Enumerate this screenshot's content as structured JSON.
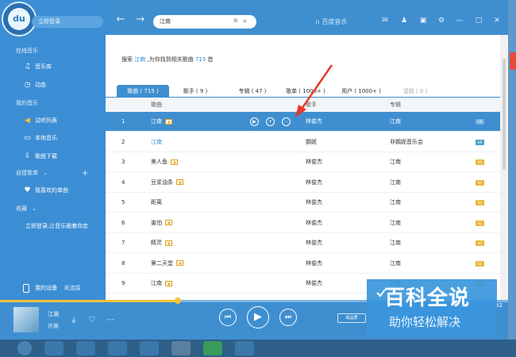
{
  "app": {
    "login_label": "立即登录",
    "logo_text": "du"
  },
  "sidebar": {
    "sections": [
      {
        "title": "在线音乐",
        "items": [
          {
            "label": "音乐库",
            "icon": "music-note-icon"
          },
          {
            "label": "动态",
            "icon": "clock-icon"
          }
        ]
      },
      {
        "title": "我的音乐",
        "items": [
          {
            "label": "试听列表",
            "icon": "speaker-icon"
          },
          {
            "label": "本地音乐",
            "icon": "monitor-icon"
          },
          {
            "label": "歌曲下载",
            "icon": "download-icon"
          }
        ]
      }
    ],
    "playlists_title": "自建歌单",
    "favorites_label": "我喜欢的单曲",
    "collection_title": "收藏",
    "login_prompt": "立即登录,让音乐跟着你走",
    "device_label": "我的设备",
    "device_status": "未连接"
  },
  "topbar": {
    "search_value": "江南",
    "brand": "百度音乐"
  },
  "results": {
    "prefix": "搜索",
    "keyword": "江南",
    "middle": ",为你找到相关歌曲",
    "count": "715",
    "suffix": "首"
  },
  "tabs": [
    {
      "label": "歌曲 ( 715 )",
      "active": true
    },
    {
      "label": "歌手 ( 9 )"
    },
    {
      "label": "专辑 ( 47 )"
    },
    {
      "label": "歌单 ( 1000+ )"
    },
    {
      "label": "用户 ( 1000+ )"
    },
    {
      "label": "话题 ( 0 )",
      "dim": true
    }
  ],
  "columns": {
    "song": "歌曲",
    "artist": "歌手",
    "album": "专辑"
  },
  "rows": [
    {
      "num": "1",
      "song": "江南",
      "mv": true,
      "artist": "林俊杰",
      "album": "江南",
      "quality": "HR",
      "selected": true
    },
    {
      "num": "2",
      "song": "江南",
      "mv": false,
      "artist": "鹦妮",
      "album": "非鹦妮音乐会",
      "quality": "HR",
      "link": true
    },
    {
      "num": "3",
      "song": "美人鱼",
      "mv": true,
      "artist": "林俊杰",
      "album": "江南",
      "quality": "SQ"
    },
    {
      "num": "4",
      "song": "豆浆油条",
      "mv": true,
      "artist": "林俊杰",
      "album": "江南",
      "quality": "SQ"
    },
    {
      "num": "5",
      "song": "距离",
      "mv": false,
      "artist": "林俊杰",
      "album": "江南",
      "quality": "SQ"
    },
    {
      "num": "6",
      "song": "害怕",
      "mv": true,
      "artist": "林俊杰",
      "album": "江南",
      "quality": "SQ"
    },
    {
      "num": "7",
      "song": "精灵",
      "mv": true,
      "artist": "林俊杰",
      "album": "江南",
      "quality": "SQ"
    },
    {
      "num": "8",
      "song": "第二天堂",
      "mv": true,
      "artist": "林俊杰",
      "album": "江南",
      "quality": "SQ"
    },
    {
      "num": "9",
      "song": "江南",
      "mv": true,
      "artist": "林俊杰",
      "album": "江南",
      "quality": "SQ"
    }
  ],
  "player": {
    "title": "江湖",
    "artist": "许嵩",
    "quality_label": "高品质",
    "time": "32",
    "progress": 0.35
  },
  "watermark": {
    "line1": "百科全说",
    "line2": "助你轻松解决"
  },
  "colors": {
    "accent": "#3f8fd0",
    "link": "#2b8ad6",
    "mv": "#e0a020",
    "arrow": "#e53b2b"
  }
}
